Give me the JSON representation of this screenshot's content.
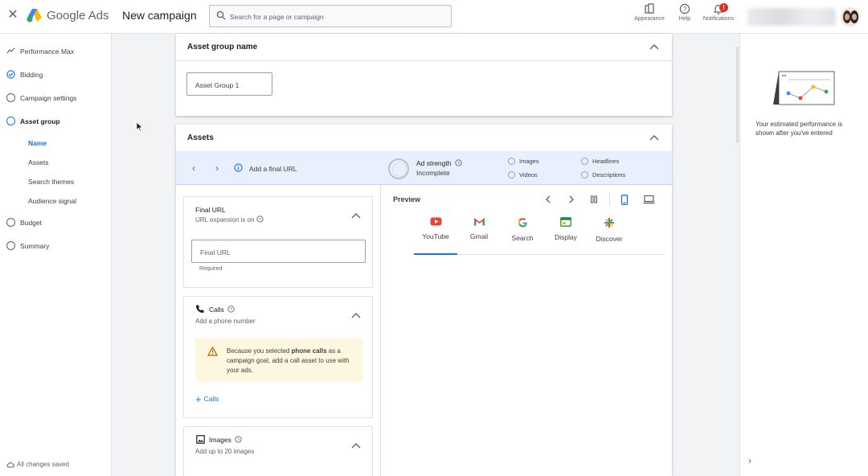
{
  "header": {
    "brand": "Google Ads",
    "campaign_title": "New campaign",
    "search_placeholder": "Search for a page or campaign",
    "appearance": "Appearance",
    "help": "Help",
    "notifications": "Notifications",
    "notification_badge": "!"
  },
  "sidebar": {
    "items": [
      {
        "label": "Performance Max",
        "icon": "performance-icon"
      },
      {
        "label": "Bidding",
        "icon": "check-circle-icon"
      },
      {
        "label": "Campaign settings",
        "icon": "circle-icon"
      },
      {
        "label": "Asset group",
        "icon": "circle-icon"
      },
      {
        "label": "Budget",
        "icon": "circle-icon"
      },
      {
        "label": "Summary",
        "icon": "circle-icon"
      }
    ],
    "sub_items": [
      {
        "label": "Name",
        "active": true
      },
      {
        "label": "Assets",
        "active": false
      },
      {
        "label": "Search themes",
        "active": false
      },
      {
        "label": "Audience signal",
        "active": false
      }
    ],
    "footer": "All changes saved"
  },
  "asset_group_card": {
    "title": "Asset group name",
    "value": "Asset Group 1"
  },
  "assets_card": {
    "title": "Assets",
    "add_final_url": "Add a final URL",
    "ad_strength_label": "Ad strength",
    "ad_strength_value": "Incomplete",
    "checklist": [
      "Images",
      "Videos",
      "Headlines",
      "Descriptions"
    ]
  },
  "final_url": {
    "title": "Final URL",
    "subtitle": "URL expansion is on",
    "placeholder": "Final URL",
    "hint": "Required"
  },
  "calls": {
    "title": "Calls",
    "subtitle": "Add a phone number",
    "warning_pre": "Because you selected ",
    "warning_bold": "phone calls",
    "warning_post": " as a campaign goal, add a call asset to use with your ads.",
    "add_label": "Calls"
  },
  "images": {
    "title": "Images",
    "subtitle": "Add up to 20 images"
  },
  "preview": {
    "title": "Preview",
    "tabs": [
      "YouTube",
      "Gmail",
      "Search",
      "Display",
      "Discover"
    ],
    "active_tab": "YouTube"
  },
  "right_panel": {
    "text": "Your estimated performance is shown after you've entered"
  },
  "colors": {
    "accent": "#1a73e8",
    "warning_bg": "#fef7e0",
    "strip_bg": "#e8f0fe"
  }
}
